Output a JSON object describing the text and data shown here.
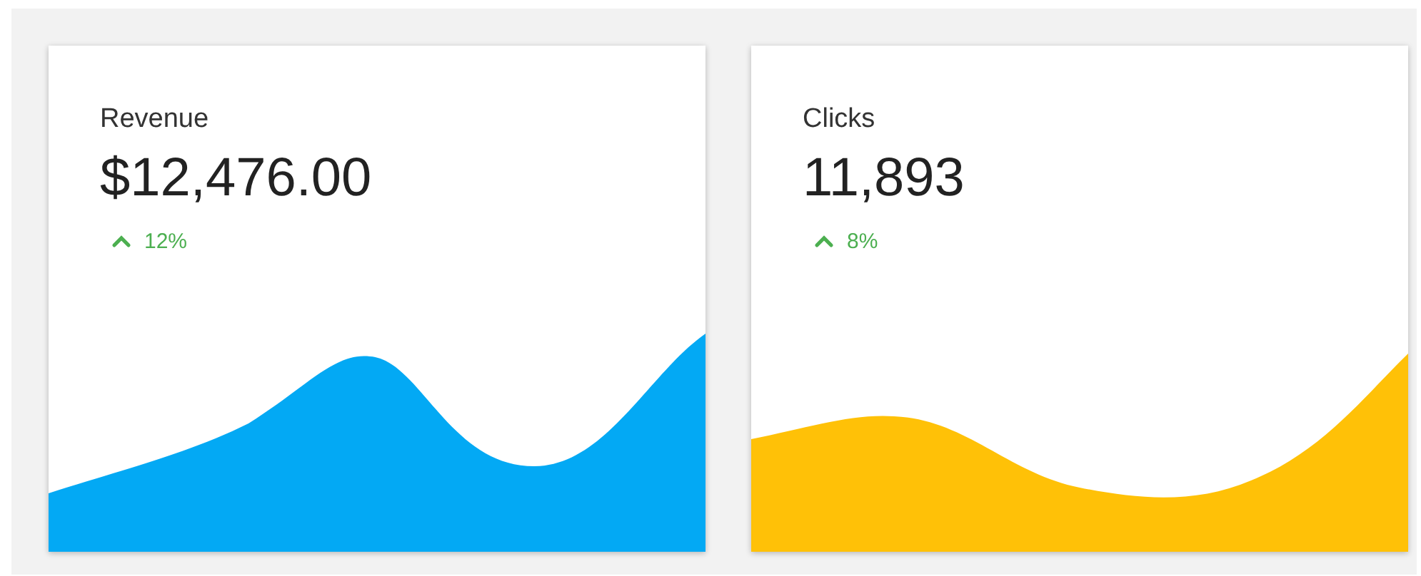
{
  "cards": [
    {
      "title": "Revenue",
      "value": "$12,476.00",
      "trend": {
        "kind": "up",
        "change": "12%"
      },
      "color": "#03a9f4"
    },
    {
      "title": "Clicks",
      "value": "11,893",
      "trend": {
        "kind": "up",
        "change": "8%"
      },
      "color": "#ffc107"
    }
  ]
}
